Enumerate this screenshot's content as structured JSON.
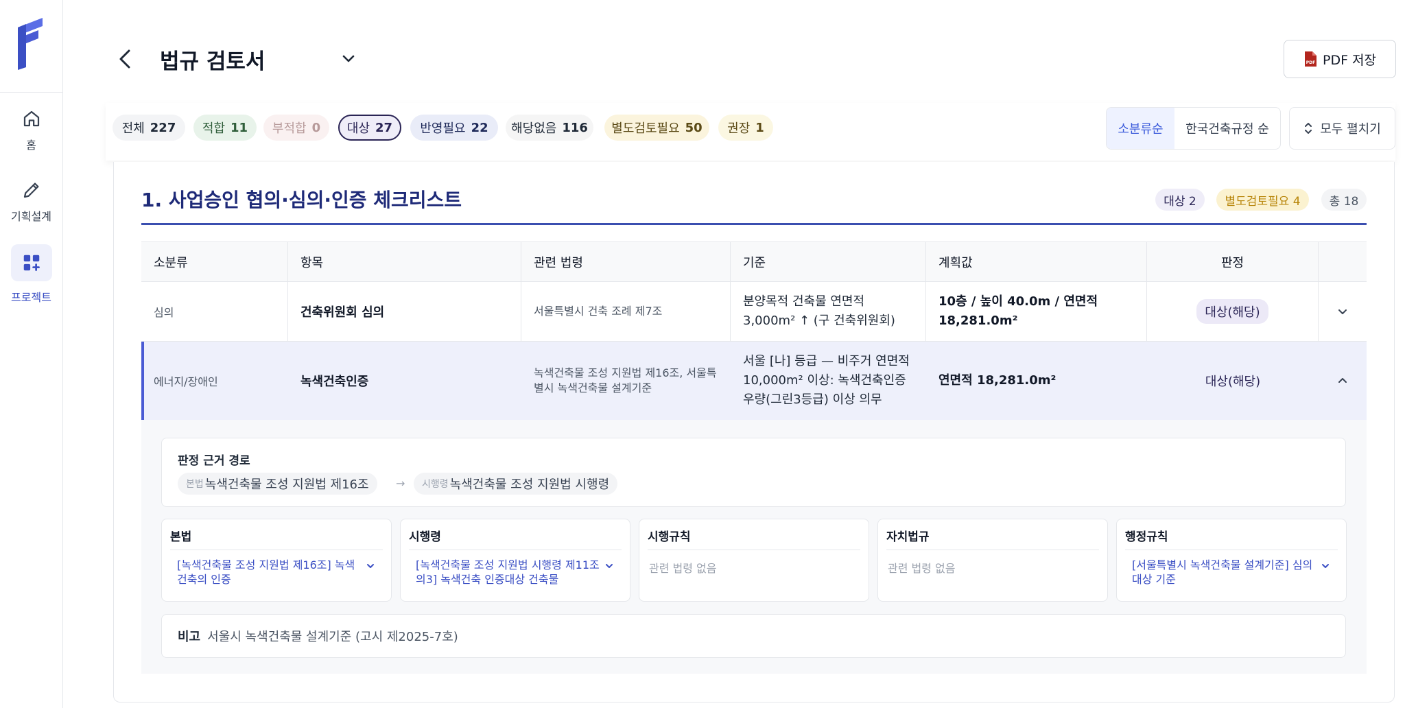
{
  "sidebar": {
    "items": [
      {
        "label": "홈",
        "icon": "home-icon"
      },
      {
        "label": "기획설계",
        "icon": "pencil-icon"
      },
      {
        "label": "프로젝트",
        "icon": "grid-plus-icon",
        "active": true
      }
    ]
  },
  "header": {
    "title": "법규 검토서",
    "pdf_label": "PDF 저장",
    "pdf_icon_text": "PDF"
  },
  "filters": [
    {
      "label": "전체",
      "count": "227",
      "bg": "#f3f4f6",
      "color": "#1f2937"
    },
    {
      "label": "적합",
      "count": "11",
      "bg": "#e8f3ea",
      "color": "#2f5e3a"
    },
    {
      "label": "부적합",
      "count": "0",
      "bg": "#faf1f1",
      "color": "#b79a9a"
    },
    {
      "label": "대상",
      "count": "27",
      "bg": "#efedf8",
      "color": "#2a2455",
      "selected": true
    },
    {
      "label": "반영필요",
      "count": "22",
      "bg": "#e9ecf8",
      "color": "#1f2a5a"
    },
    {
      "label": "해당없음",
      "count": "116",
      "bg": "#f5f5f5",
      "color": "#1f2937"
    },
    {
      "label": "별도검토필요",
      "count": "50",
      "bg": "#fbf4dd",
      "color": "#5b4a16"
    },
    {
      "label": "권장",
      "count": "1",
      "bg": "#fbf7e2",
      "color": "#5b4a16"
    }
  ],
  "sort": {
    "options": [
      "소분류순",
      "한국건축규정 순"
    ],
    "active": "소분류순"
  },
  "expand_all_label": "모두 펼치기",
  "section": {
    "title": "1. 사업승인 협의·심의·인증 체크리스트",
    "badges": [
      {
        "label": "대상 2",
        "bg": "#efedf8",
        "color": "#2a2455"
      },
      {
        "label": "별도검토필요 4",
        "bg": "#fbf2d0",
        "color": "#b8860b"
      },
      {
        "label": "총 18",
        "bg": "#f3f4f6",
        "color": "#4b5563"
      }
    ]
  },
  "table": {
    "headers": [
      "소분류",
      "항목",
      "관련 법령",
      "기준",
      "계획값",
      "판정"
    ],
    "rows": [
      {
        "category": "심의",
        "item": "건축위원회 심의",
        "law": "서울특별시 건축 조례 제7조",
        "standard": "분양목적 건축물 연면적 3,000m² ↑ (구 건축위원회)",
        "plan": "10층 / 높이 40.0m / 연면적 18,281.0m²",
        "verdict": "대상(해당)"
      },
      {
        "category": "에너지/장애인",
        "item": "녹색건축인증",
        "law": "녹색건축물 조성 지원법 제16조, 서울특별시 녹색건축물 설계기준",
        "standard": "서울 [나] 등급 — 비주거 연면적 10,000m² 이상: 녹색건축인증 우량(그린3등급) 이상 의무",
        "plan": "연면적 18,281.0m²",
        "verdict": "대상(해당)"
      }
    ]
  },
  "detail": {
    "path_title": "판정 근거 경로",
    "path": [
      {
        "prefix": "본법",
        "value": "녹색건축물 조성 지원법 제16조"
      },
      {
        "prefix": "시행령",
        "value": "녹색건축물 조성 지원법 시행령"
      }
    ],
    "law_cards": [
      {
        "title": "본법",
        "link": "[녹색건축물 조성 지원법 제16조] 녹색건축의 인증"
      },
      {
        "title": "시행령",
        "link": "[녹색건축물 조성 지원법 시행령 제11조의3] 녹색건축 인증대상 건축물"
      },
      {
        "title": "시행규칙",
        "none": "관련 법령 없음"
      },
      {
        "title": "자치법규",
        "none": "관련 법령 없음"
      },
      {
        "title": "행정규칙",
        "link": "[서울특별시 녹색건축물 설계기준] 심의대상 기준"
      }
    ],
    "note_label": "비고",
    "note_value": "서울시 녹색건축물 설계기준 (고시 제2025-7호)"
  }
}
